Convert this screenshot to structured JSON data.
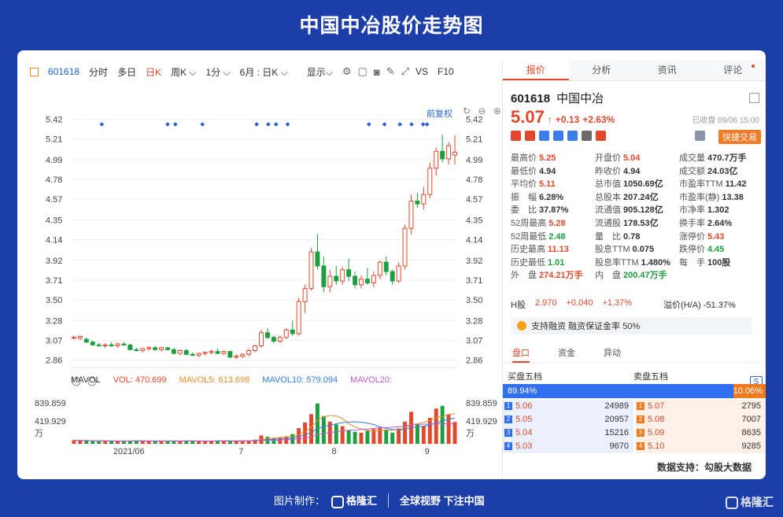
{
  "header": {
    "title": "中国中冶股价走势图"
  },
  "toolbar": {
    "code": "601618",
    "items": [
      "分时",
      "多日"
    ],
    "active": "日K",
    "dropdowns": [
      "周K ⌵",
      "1分 ⌵",
      "6月 : 日K ⌵"
    ],
    "display": "显示⌵",
    "vs": "VS",
    "f10": "F10"
  },
  "chart_controls": {
    "restore": "前复权",
    "icons": "↻ ⊖ ⊕"
  },
  "price_chart": {
    "type": "candlestick",
    "yticks": [
      "5.42",
      "5.21",
      "4.99",
      "4.78",
      "4.57",
      "4.35",
      "4.14",
      "3.92",
      "3.71",
      "3.50",
      "3.28",
      "3.07",
      "2.86"
    ],
    "ylim": [
      2.78,
      5.45
    ],
    "xticks": [
      "2021/06",
      "7",
      "8",
      "9"
    ],
    "volume_yticks": [
      "839.859",
      "419.929",
      "万"
    ],
    "volume_max": 950
  },
  "mavol_row": {
    "label": "MAVOL",
    "vol": "VOL: 470.699",
    "ma5": "MAVOL5: 613.698",
    "ma10": "MAVOL10: 579.094",
    "ma20": "MAVOL20:"
  },
  "chart_data": {
    "type": "candlestick",
    "candles": [
      {
        "o": 3.1,
        "h": 3.12,
        "l": 3.08,
        "c": 3.1
      },
      {
        "o": 3.09,
        "h": 3.12,
        "l": 3.07,
        "c": 3.11
      },
      {
        "o": 3.08,
        "h": 3.1,
        "l": 3.04,
        "c": 3.05
      },
      {
        "o": 3.05,
        "h": 3.07,
        "l": 3.01,
        "c": 3.02
      },
      {
        "o": 3.02,
        "h": 3.04,
        "l": 3.0,
        "c": 3.01
      },
      {
        "o": 3.01,
        "h": 3.04,
        "l": 2.99,
        "c": 3.02
      },
      {
        "o": 3.02,
        "h": 3.05,
        "l": 3.0,
        "c": 3.01
      },
      {
        "o": 3.01,
        "h": 3.04,
        "l": 2.99,
        "c": 3.03
      },
      {
        "o": 3.03,
        "h": 3.05,
        "l": 3.01,
        "c": 3.02
      },
      {
        "o": 3.02,
        "h": 3.03,
        "l": 2.96,
        "c": 2.97
      },
      {
        "o": 2.97,
        "h": 2.99,
        "l": 2.95,
        "c": 2.96
      },
      {
        "o": 2.96,
        "h": 2.99,
        "l": 2.94,
        "c": 2.98
      },
      {
        "o": 2.98,
        "h": 3.01,
        "l": 2.96,
        "c": 2.99
      },
      {
        "o": 2.99,
        "h": 3.01,
        "l": 2.96,
        "c": 2.97
      },
      {
        "o": 2.97,
        "h": 3.0,
        "l": 2.95,
        "c": 2.99
      },
      {
        "o": 2.99,
        "h": 3.0,
        "l": 2.96,
        "c": 2.97
      },
      {
        "o": 2.97,
        "h": 2.99,
        "l": 2.92,
        "c": 2.93
      },
      {
        "o": 2.93,
        "h": 2.97,
        "l": 2.91,
        "c": 2.96
      },
      {
        "o": 2.96,
        "h": 2.98,
        "l": 2.91,
        "c": 2.92
      },
      {
        "o": 2.92,
        "h": 2.94,
        "l": 2.9,
        "c": 2.91
      },
      {
        "o": 2.91,
        "h": 2.94,
        "l": 2.89,
        "c": 2.93
      },
      {
        "o": 2.93,
        "h": 2.95,
        "l": 2.91,
        "c": 2.94
      },
      {
        "o": 2.94,
        "h": 2.97,
        "l": 2.92,
        "c": 2.95
      },
      {
        "o": 2.95,
        "h": 2.98,
        "l": 2.92,
        "c": 2.93
      },
      {
        "o": 2.93,
        "h": 2.96,
        "l": 2.91,
        "c": 2.95
      },
      {
        "o": 2.95,
        "h": 2.96,
        "l": 2.88,
        "c": 2.89
      },
      {
        "o": 2.89,
        "h": 2.92,
        "l": 2.87,
        "c": 2.9
      },
      {
        "o": 2.9,
        "h": 2.93,
        "l": 2.88,
        "c": 2.92
      },
      {
        "o": 2.92,
        "h": 2.98,
        "l": 2.9,
        "c": 2.96
      },
      {
        "o": 2.96,
        "h": 3.02,
        "l": 2.94,
        "c": 3.01
      },
      {
        "o": 3.01,
        "h": 3.18,
        "l": 2.99,
        "c": 3.15
      },
      {
        "o": 3.15,
        "h": 3.2,
        "l": 3.08,
        "c": 3.1
      },
      {
        "o": 3.1,
        "h": 3.12,
        "l": 3.04,
        "c": 3.06
      },
      {
        "o": 3.06,
        "h": 3.12,
        "l": 3.04,
        "c": 3.1
      },
      {
        "o": 3.1,
        "h": 3.2,
        "l": 3.08,
        "c": 3.18
      },
      {
        "o": 3.18,
        "h": 3.28,
        "l": 3.12,
        "c": 3.14
      },
      {
        "o": 3.14,
        "h": 3.52,
        "l": 3.12,
        "c": 3.48
      },
      {
        "o": 3.48,
        "h": 3.66,
        "l": 3.36,
        "c": 3.62
      },
      {
        "o": 3.62,
        "h": 4.05,
        "l": 3.6,
        "c": 4.01
      },
      {
        "o": 4.01,
        "h": 4.2,
        "l": 3.82,
        "c": 3.86
      },
      {
        "o": 3.86,
        "h": 3.96,
        "l": 3.58,
        "c": 3.64
      },
      {
        "o": 3.64,
        "h": 3.82,
        "l": 3.58,
        "c": 3.75
      },
      {
        "o": 3.75,
        "h": 3.86,
        "l": 3.66,
        "c": 3.7
      },
      {
        "o": 3.7,
        "h": 3.85,
        "l": 3.66,
        "c": 3.82
      },
      {
        "o": 3.82,
        "h": 3.94,
        "l": 3.7,
        "c": 3.75
      },
      {
        "o": 3.75,
        "h": 3.8,
        "l": 3.62,
        "c": 3.66
      },
      {
        "o": 3.66,
        "h": 3.76,
        "l": 3.62,
        "c": 3.72
      },
      {
        "o": 3.72,
        "h": 3.84,
        "l": 3.66,
        "c": 3.68
      },
      {
        "o": 3.68,
        "h": 3.8,
        "l": 3.63,
        "c": 3.76
      },
      {
        "o": 3.76,
        "h": 3.92,
        "l": 3.72,
        "c": 3.9
      },
      {
        "o": 3.9,
        "h": 3.96,
        "l": 3.76,
        "c": 3.8
      },
      {
        "o": 3.8,
        "h": 3.82,
        "l": 3.66,
        "c": 3.7
      },
      {
        "o": 3.7,
        "h": 3.9,
        "l": 3.68,
        "c": 3.86
      },
      {
        "o": 3.86,
        "h": 4.3,
        "l": 3.82,
        "c": 4.26
      },
      {
        "o": 4.26,
        "h": 4.62,
        "l": 4.2,
        "c": 4.55
      },
      {
        "o": 4.55,
        "h": 4.64,
        "l": 4.48,
        "c": 4.52
      },
      {
        "o": 4.52,
        "h": 4.7,
        "l": 4.46,
        "c": 4.62
      },
      {
        "o": 4.62,
        "h": 4.96,
        "l": 4.58,
        "c": 4.9
      },
      {
        "o": 4.9,
        "h": 5.12,
        "l": 4.82,
        "c": 5.08
      },
      {
        "o": 5.08,
        "h": 5.26,
        "l": 4.96,
        "c": 5.0
      },
      {
        "o": 5.0,
        "h": 5.18,
        "l": 4.94,
        "c": 5.14
      },
      {
        "o": 5.04,
        "h": 5.25,
        "l": 4.94,
        "c": 5.07
      }
    ],
    "volumes": [
      78,
      65,
      70,
      58,
      52,
      60,
      55,
      62,
      58,
      66,
      72,
      60,
      55,
      58,
      62,
      57,
      70,
      64,
      60,
      58,
      55,
      60,
      66,
      70,
      62,
      64,
      58,
      60,
      74,
      90,
      180,
      150,
      120,
      140,
      160,
      210,
      340,
      460,
      640,
      870,
      600,
      480,
      420,
      380,
      300,
      260,
      240,
      280,
      320,
      350,
      300,
      240,
      330,
      480,
      690,
      420,
      380,
      560,
      760,
      820,
      640,
      471
    ],
    "ylim": [
      2.78,
      5.45
    ]
  },
  "quote": {
    "tabs": [
      "报价",
      "分析",
      "资讯",
      "评论"
    ],
    "code": "601618",
    "name": "中国中冶",
    "price": "5.07",
    "arrow": "↑",
    "change": "+0.13",
    "change_pct": "+2.63%",
    "closed": "已收盘 09/06 15:00",
    "fast_trade": "快捷交易",
    "icon_colors": [
      "#e2482c",
      "#e0472d",
      "#3d7be8",
      "#3d7be8",
      "#3d7be8",
      "#6a6a6a",
      "#e2482c"
    ],
    "fields": [
      {
        "l": "最高价",
        "v": "5.25",
        "c": "red"
      },
      {
        "l": "开盘价",
        "v": "5.04",
        "c": "red"
      },
      {
        "l": "成交量",
        "v": "470.7万手",
        "c": ""
      },
      {
        "l": "最低价",
        "v": "4.94",
        "c": ""
      },
      {
        "l": "昨收价",
        "v": "4.94",
        "c": ""
      },
      {
        "l": "成交额",
        "v": "24.03亿",
        "c": ""
      },
      {
        "l": "平均价",
        "v": "5.11",
        "c": "red"
      },
      {
        "l": "总市值",
        "v": "1050.69亿",
        "c": ""
      },
      {
        "l": "市盈率TTM",
        "v": "11.42",
        "c": ""
      },
      {
        "l": "振　幅",
        "v": "6.28%",
        "c": ""
      },
      {
        "l": "总股本",
        "v": "207.24亿",
        "c": ""
      },
      {
        "l": "市盈率(静)",
        "v": "13.38",
        "c": ""
      },
      {
        "l": "委　比",
        "v": "37.87%",
        "c": ""
      },
      {
        "l": "流通值",
        "v": "905.128亿",
        "c": ""
      },
      {
        "l": "市净率",
        "v": "1.302",
        "c": ""
      },
      {
        "l": "52周最高",
        "v": "5.28",
        "c": "red"
      },
      {
        "l": "流通股",
        "v": "178.53亿",
        "c": ""
      },
      {
        "l": "换手率",
        "v": "2.64%",
        "c": ""
      },
      {
        "l": "52周最低",
        "v": "2.48",
        "c": "green"
      },
      {
        "l": "量　比",
        "v": "0.78",
        "c": ""
      },
      {
        "l": "涨停价",
        "v": "5.43",
        "c": "red"
      },
      {
        "l": "历史最高",
        "v": "11.13",
        "c": "red"
      },
      {
        "l": "股息TTM",
        "v": "0.075",
        "c": ""
      },
      {
        "l": "跌停价",
        "v": "4.45",
        "c": "green"
      },
      {
        "l": "历史最低",
        "v": "1.01",
        "c": "green"
      },
      {
        "l": "股息率TTM",
        "v": "1.480%",
        "c": ""
      },
      {
        "l": "每　手",
        "v": "100股",
        "c": ""
      },
      {
        "l": "外　盘",
        "v": "274.21万手",
        "c": "red"
      },
      {
        "l": "内　盘",
        "v": "200.47万手",
        "c": "green"
      },
      {
        "l": "",
        "v": "",
        "c": ""
      }
    ],
    "h_label": "H股",
    "h_price": "2.970",
    "h_change": "+0.040",
    "h_pct": "+1.37%",
    "premium": "溢价(H/A)  -51.37%",
    "margin": "支持融资 融资保证金率 50%",
    "subtabs": [
      "盘口",
      "资金",
      "异动"
    ],
    "buy_title": "买盘五档",
    "sell_title": "卖盘五档",
    "s_button": "S",
    "buy_ratio": "89.94%",
    "sell_ratio": "10.06%",
    "buy_ratio_value": 89.94,
    "book": [
      {
        "bi": "1",
        "bp": "5.06",
        "bq": "24989",
        "si": "1",
        "sp": "5.07",
        "sq": "2795"
      },
      {
        "bi": "2",
        "bp": "5.05",
        "bq": "20957",
        "si": "2",
        "sp": "5.08",
        "sq": "7007"
      },
      {
        "bi": "3",
        "bp": "5.04",
        "bq": "15216",
        "si": "3",
        "sp": "5.09",
        "sq": "8635"
      },
      {
        "bi": "4",
        "bp": "5.03",
        "bq": "9670",
        "si": "4",
        "sp": "5.10",
        "sq": "9285"
      }
    ]
  },
  "support": "数据支持：勾股大数据",
  "footer": {
    "credit_label": "图片制作：",
    "brand": "格隆汇",
    "slogan": "全球视野 下注中国",
    "corner": "格隆汇"
  }
}
